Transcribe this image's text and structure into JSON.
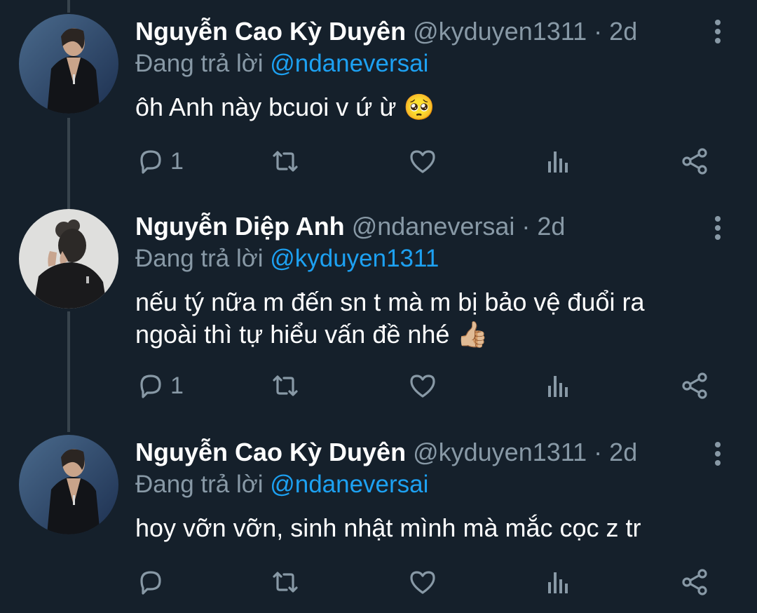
{
  "tweets": [
    {
      "display_name": "Nguyễn Cao Kỳ Duyên",
      "handle": "@kyduyen1311",
      "dot": "·",
      "time": "2d",
      "reply_prefix": "Đang trả lời",
      "reply_to": "@ndaneversai",
      "text": "ôh Anh này bcuoi v ứ ừ",
      "emoji": "🥺",
      "reply_count": "1"
    },
    {
      "display_name": "Nguyễn Diệp Anh",
      "handle": "@ndaneversai",
      "dot": "·",
      "time": "2d",
      "reply_prefix": "Đang trả lời",
      "reply_to": "@kyduyen1311",
      "text": "nếu tý nữa m đến sn t mà m bị bảo vệ đuổi ra ngoài thì tự hiểu vấn đề nhé",
      "emoji": "👍🏼",
      "reply_count": "1"
    },
    {
      "display_name": "Nguyễn Cao Kỳ Duyên",
      "handle": "@kyduyen1311",
      "dot": "·",
      "time": "2d",
      "reply_prefix": "Đang trả lời",
      "reply_to": "@ndaneversai",
      "text": "hoy vỡn vỡn, sinh nhật mình mà mắc cọc z tr",
      "emoji": "",
      "reply_count": ""
    }
  ],
  "icons": {
    "reply": "speech-bubble-icon",
    "retweet": "retweet-icon",
    "like": "heart-icon",
    "analytics": "bar-chart-icon",
    "share": "share-icon",
    "more": "vertical-dots-icon"
  },
  "colors": {
    "background": "#15202b",
    "text": "#ffffff",
    "muted": "#8899a6",
    "link": "#1da1f2",
    "thread_line": "#38444d"
  }
}
